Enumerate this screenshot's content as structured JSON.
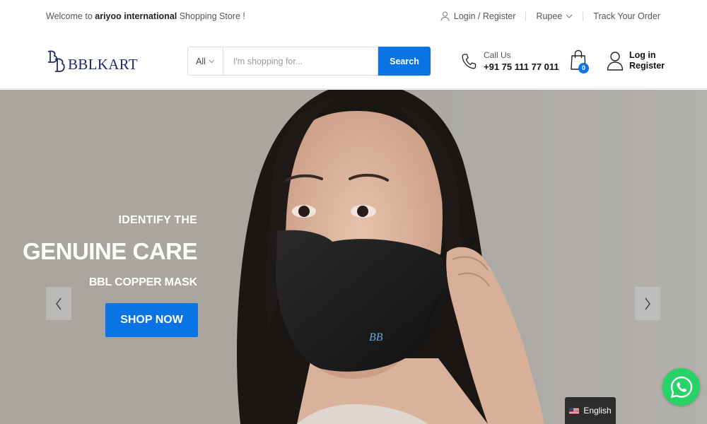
{
  "topbar": {
    "welcome_prefix": "Welcome to ",
    "welcome_store": "ariyoo international",
    "welcome_suffix": " Shopping Store !",
    "login_register": "Login / Register",
    "currency": "Rupee",
    "track_order": "Track Your Order"
  },
  "header": {
    "logo_text": "BBLKART",
    "search": {
      "category": "All",
      "placeholder": "I'm shopping for...",
      "button": "Search"
    },
    "call": {
      "label": "Call Us",
      "number": "+91 75 111 77 011"
    },
    "cart_count": "0",
    "account": {
      "login": "Log in",
      "register": "Register"
    }
  },
  "hero": {
    "line1": "IDENTIFY THE",
    "line2": "GENUINE CARE",
    "line3": "BBL COPPER MASK",
    "cta": "SHOP NOW"
  },
  "language": "English",
  "colors": {
    "accent": "#0a74e4",
    "logo": "#1f2a6b",
    "whatsapp": "#25d366"
  },
  "icons": [
    "user-icon",
    "chevron-down-icon",
    "phone-icon",
    "shopping-bag-icon",
    "account-icon",
    "arrow-left-icon",
    "arrow-right-icon",
    "us-flag-icon",
    "whatsapp-icon"
  ]
}
